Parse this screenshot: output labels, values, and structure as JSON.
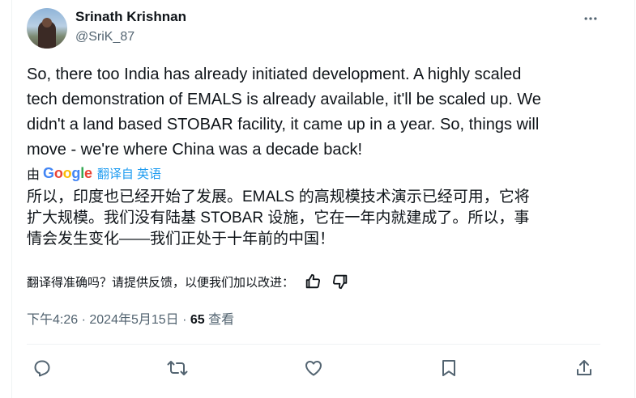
{
  "author": {
    "name": "Srinath Krishnan",
    "handle": "@SriK_87"
  },
  "tweet": {
    "text_lines": [
      "So, there too India has already initiated development. A highly scaled",
      "tech demonstration of EMALS is already available, it'll be scaled up. We",
      "didn't a land based STOBAR facility, it came up in a year. So, things will",
      "move - we're where China was a decade back!"
    ]
  },
  "translation": {
    "by_prefix": "由",
    "google_logo": "Google",
    "translated_from": "翻译自 英语",
    "lines": [
      "所以，印度也已经开始了发展。EMALS 的高规模技术演示已经可用，它将",
      "扩大规模。我们没有陆基 STOBAR 设施，它在一年内就建成了。所以，事",
      "情会发生变化——我们正处于十年前的中国！"
    ],
    "feedback_prompt": "翻译得准确吗？请提供反馈，以便我们加以改进："
  },
  "meta": {
    "time": "下午4:26",
    "separator": " · ",
    "date": "2024年5月15日",
    "views_count": "65",
    "views_label": " 查看"
  },
  "icons": {
    "more": "more-horizontal-icon",
    "thumbs_up": "thumbs-up-icon",
    "thumbs_down": "thumbs-down-icon",
    "reply": "reply-icon",
    "retweet": "retweet-icon",
    "like": "heart-icon",
    "bookmark": "bookmark-icon",
    "share": "share-icon"
  },
  "colors": {
    "text": "#0f1419",
    "secondary": "#536471",
    "link": "#1d9bf0",
    "divider": "#eff3f4"
  }
}
